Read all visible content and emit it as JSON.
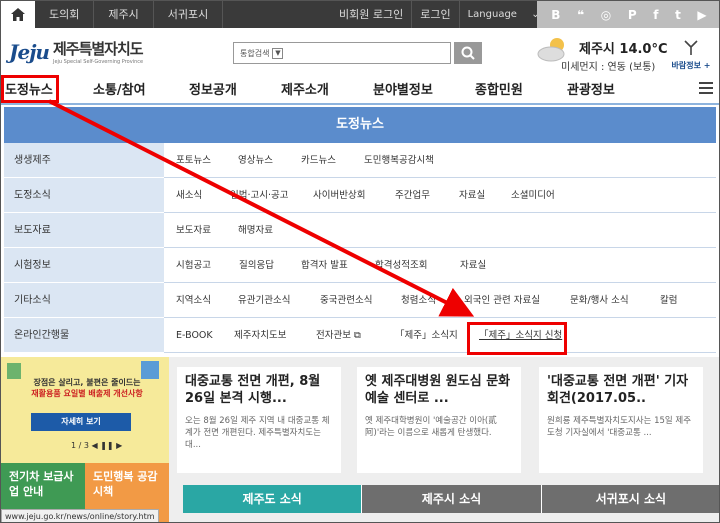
{
  "topbar": {
    "links": [
      "도의회",
      "제주시",
      "서귀포시"
    ],
    "right_links": [
      "비회원 로그인",
      "로그인"
    ],
    "language": "Language",
    "social_icons": [
      "blog-icon",
      "story-icon",
      "instagram-icon",
      "post-icon",
      "facebook-icon",
      "twitter-icon",
      "youtube-icon"
    ]
  },
  "header": {
    "logo_mark": "Jeju",
    "logo_title": "제주특별자치도",
    "logo_sub": "Jeju Special Self-Governing Province",
    "search_select": "통합검색",
    "weather_temp": "제주시 14.0°C",
    "weather_dust": "미세먼지 : 연동 (보통)",
    "wind_label": "바람정보 +"
  },
  "mainnav": {
    "items": [
      "도정뉴스",
      "소통/참여",
      "정보공개",
      "제주소개",
      "분야별정보",
      "종합민원",
      "관광정보"
    ]
  },
  "mega": {
    "title": "도정뉴스",
    "rows": [
      {
        "cat": "생생제주",
        "subs": [
          "포토뉴스",
          "영상뉴스",
          "카드뉴스",
          "도민행복공감시책"
        ]
      },
      {
        "cat": "도정소식",
        "subs": [
          "새소식",
          "입법·고시·공고",
          "사이버반상회",
          "주간업무",
          "자료실",
          "소셜미디어"
        ]
      },
      {
        "cat": "보도자료",
        "subs": [
          "보도자료",
          "해명자료"
        ]
      },
      {
        "cat": "시험정보",
        "subs": [
          "시험공고",
          "질의응답",
          "합격자 발표",
          "합격성적조회",
          "자료실"
        ]
      },
      {
        "cat": "기타소식",
        "subs": [
          "지역소식",
          "유관기관소식",
          "중국관련소식",
          "청렴소식",
          "외국인 관련 자료실",
          "문화/행사 소식",
          "칼럼"
        ]
      },
      {
        "cat": "온라인간행물",
        "subs": [
          "E-BOOK",
          "제주자치도보",
          "전자관보",
          "「제주」소식지",
          "「제주」소식지 신청"
        ]
      }
    ]
  },
  "banner": {
    "line1": "장점은 살리고, 불편은 줄이드는",
    "line2": "재활용품 요일별 배출제 개선사항",
    "button": "자세히 보기",
    "pager": "1 / 3  ◀  ❚❚  ▶"
  },
  "quick": {
    "q1": "전기차 보급사업 안내",
    "q2": "도민행복 공감시책"
  },
  "cards": [
    {
      "title": "대중교통 전면 개편, 8월 26일 본격 시행...",
      "body": "오는 8월 26일 제주 지역 내 대중교통 체계가 전면 개편된다. 제주특별자치도는 대..."
    },
    {
      "title": "옛 제주대병원 원도심 문화예술 센터로 ...",
      "body": "옛 제주대학병원이 '예술공간 이아(貳阿)'라는 이름으로 새롭게 탄생했다."
    },
    {
      "title": "'대중교통 전면 개편' 기자회견(2017.05..",
      "body": "원희룡 제주특별자치도지사는 15일 제주도청 기자실에서 '대중교통 ..."
    }
  ],
  "tabs": [
    "제주도 소식",
    "제주시 소식",
    "서귀포시 소식"
  ],
  "statusbar": "www.jeju.go.kr/news/online/story.htm",
  "colors": {
    "nav_blue": "#5b8ccc",
    "highlight": "#e00000",
    "active_tab": "#2aa7a4"
  }
}
